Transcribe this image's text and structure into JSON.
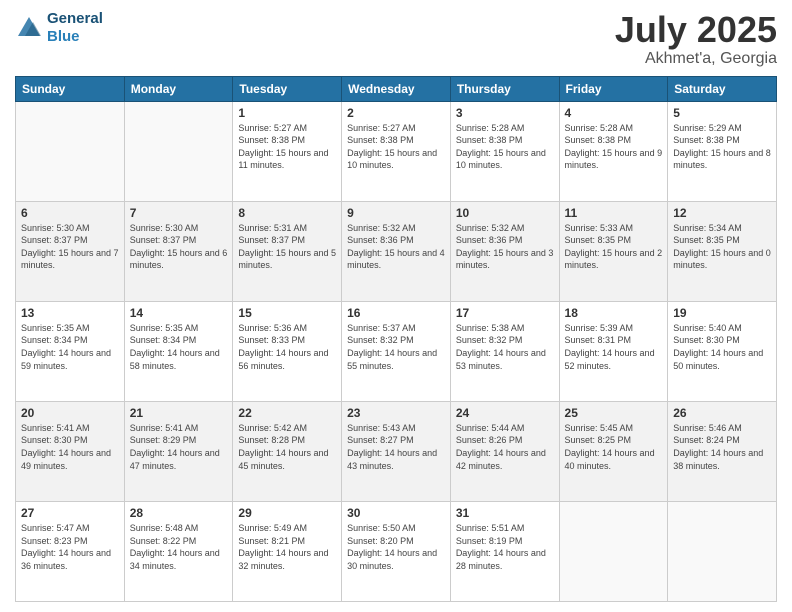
{
  "header": {
    "logo_line1": "General",
    "logo_line2": "Blue",
    "title": "July 2025",
    "location": "Akhmet'a, Georgia"
  },
  "weekdays": [
    "Sunday",
    "Monday",
    "Tuesday",
    "Wednesday",
    "Thursday",
    "Friday",
    "Saturday"
  ],
  "weeks": [
    [
      {
        "day": "",
        "info": ""
      },
      {
        "day": "",
        "info": ""
      },
      {
        "day": "1",
        "info": "Sunrise: 5:27 AM\nSunset: 8:38 PM\nDaylight: 15 hours and 11 minutes."
      },
      {
        "day": "2",
        "info": "Sunrise: 5:27 AM\nSunset: 8:38 PM\nDaylight: 15 hours and 10 minutes."
      },
      {
        "day": "3",
        "info": "Sunrise: 5:28 AM\nSunset: 8:38 PM\nDaylight: 15 hours and 10 minutes."
      },
      {
        "day": "4",
        "info": "Sunrise: 5:28 AM\nSunset: 8:38 PM\nDaylight: 15 hours and 9 minutes."
      },
      {
        "day": "5",
        "info": "Sunrise: 5:29 AM\nSunset: 8:38 PM\nDaylight: 15 hours and 8 minutes."
      }
    ],
    [
      {
        "day": "6",
        "info": "Sunrise: 5:30 AM\nSunset: 8:37 PM\nDaylight: 15 hours and 7 minutes."
      },
      {
        "day": "7",
        "info": "Sunrise: 5:30 AM\nSunset: 8:37 PM\nDaylight: 15 hours and 6 minutes."
      },
      {
        "day": "8",
        "info": "Sunrise: 5:31 AM\nSunset: 8:37 PM\nDaylight: 15 hours and 5 minutes."
      },
      {
        "day": "9",
        "info": "Sunrise: 5:32 AM\nSunset: 8:36 PM\nDaylight: 15 hours and 4 minutes."
      },
      {
        "day": "10",
        "info": "Sunrise: 5:32 AM\nSunset: 8:36 PM\nDaylight: 15 hours and 3 minutes."
      },
      {
        "day": "11",
        "info": "Sunrise: 5:33 AM\nSunset: 8:35 PM\nDaylight: 15 hours and 2 minutes."
      },
      {
        "day": "12",
        "info": "Sunrise: 5:34 AM\nSunset: 8:35 PM\nDaylight: 15 hours and 0 minutes."
      }
    ],
    [
      {
        "day": "13",
        "info": "Sunrise: 5:35 AM\nSunset: 8:34 PM\nDaylight: 14 hours and 59 minutes."
      },
      {
        "day": "14",
        "info": "Sunrise: 5:35 AM\nSunset: 8:34 PM\nDaylight: 14 hours and 58 minutes."
      },
      {
        "day": "15",
        "info": "Sunrise: 5:36 AM\nSunset: 8:33 PM\nDaylight: 14 hours and 56 minutes."
      },
      {
        "day": "16",
        "info": "Sunrise: 5:37 AM\nSunset: 8:32 PM\nDaylight: 14 hours and 55 minutes."
      },
      {
        "day": "17",
        "info": "Sunrise: 5:38 AM\nSunset: 8:32 PM\nDaylight: 14 hours and 53 minutes."
      },
      {
        "day": "18",
        "info": "Sunrise: 5:39 AM\nSunset: 8:31 PM\nDaylight: 14 hours and 52 minutes."
      },
      {
        "day": "19",
        "info": "Sunrise: 5:40 AM\nSunset: 8:30 PM\nDaylight: 14 hours and 50 minutes."
      }
    ],
    [
      {
        "day": "20",
        "info": "Sunrise: 5:41 AM\nSunset: 8:30 PM\nDaylight: 14 hours and 49 minutes."
      },
      {
        "day": "21",
        "info": "Sunrise: 5:41 AM\nSunset: 8:29 PM\nDaylight: 14 hours and 47 minutes."
      },
      {
        "day": "22",
        "info": "Sunrise: 5:42 AM\nSunset: 8:28 PM\nDaylight: 14 hours and 45 minutes."
      },
      {
        "day": "23",
        "info": "Sunrise: 5:43 AM\nSunset: 8:27 PM\nDaylight: 14 hours and 43 minutes."
      },
      {
        "day": "24",
        "info": "Sunrise: 5:44 AM\nSunset: 8:26 PM\nDaylight: 14 hours and 42 minutes."
      },
      {
        "day": "25",
        "info": "Sunrise: 5:45 AM\nSunset: 8:25 PM\nDaylight: 14 hours and 40 minutes."
      },
      {
        "day": "26",
        "info": "Sunrise: 5:46 AM\nSunset: 8:24 PM\nDaylight: 14 hours and 38 minutes."
      }
    ],
    [
      {
        "day": "27",
        "info": "Sunrise: 5:47 AM\nSunset: 8:23 PM\nDaylight: 14 hours and 36 minutes."
      },
      {
        "day": "28",
        "info": "Sunrise: 5:48 AM\nSunset: 8:22 PM\nDaylight: 14 hours and 34 minutes."
      },
      {
        "day": "29",
        "info": "Sunrise: 5:49 AM\nSunset: 8:21 PM\nDaylight: 14 hours and 32 minutes."
      },
      {
        "day": "30",
        "info": "Sunrise: 5:50 AM\nSunset: 8:20 PM\nDaylight: 14 hours and 30 minutes."
      },
      {
        "day": "31",
        "info": "Sunrise: 5:51 AM\nSunset: 8:19 PM\nDaylight: 14 hours and 28 minutes."
      },
      {
        "day": "",
        "info": ""
      },
      {
        "day": "",
        "info": ""
      }
    ]
  ]
}
